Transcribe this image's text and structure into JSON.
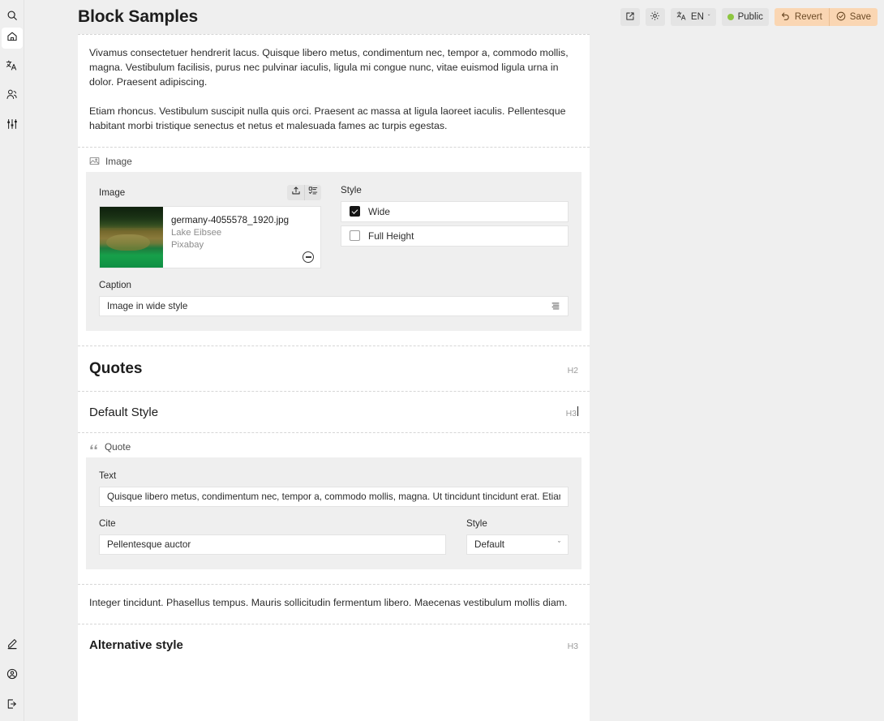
{
  "sidebar": {
    "search_icon": "search-icon",
    "top_items": [
      {
        "icon": "home-icon",
        "name": "home",
        "active": true
      },
      {
        "icon": "translate-icon",
        "name": "translations",
        "active": false
      },
      {
        "icon": "users-icon",
        "name": "users",
        "active": false
      },
      {
        "icon": "sliders-icon",
        "name": "settings",
        "active": false
      }
    ],
    "bottom_items": [
      {
        "icon": "pencil-icon",
        "name": "edit"
      },
      {
        "icon": "account-circle-icon",
        "name": "account"
      },
      {
        "icon": "logout-icon",
        "name": "logout"
      }
    ]
  },
  "header": {
    "title": "Block Samples",
    "preview_icon": "external-link-icon",
    "settings_icon": "gear-icon",
    "language": {
      "icon": "translate-icon",
      "label": "EN",
      "chevron": "ˇ"
    },
    "status": {
      "label": "Public",
      "color": "#8dc63f"
    },
    "revert": {
      "label": "Revert",
      "icon": "undo-icon"
    },
    "save": {
      "label": "Save",
      "icon": "check-circle-icon"
    },
    "action_bg": "#fad6b3",
    "action_fg": "#6b4a26"
  },
  "content": {
    "intro_paragraphs": [
      "Vivamus consectetuer hendrerit lacus. Quisque libero metus, condimentum nec, tempor a, commodo mollis, magna. Vestibulum facilisis, purus nec pulvinar iaculis, ligula mi congue nunc, vitae euismod ligula urna in dolor. Praesent adipiscing.",
      "Etiam rhoncus. Vestibulum suscipit nulla quis orci. Praesent ac massa at ligula laoreet iaculis. Pellentesque habitant morbi tristique senectus et netus et malesuada fames ac turpis egestas."
    ],
    "image_block": {
      "block_label": "Image",
      "block_icon": "image-icon",
      "image_field_label": "Image",
      "upload_icon": "upload-icon",
      "browse_icon": "media-list-icon",
      "media": {
        "filename": "germany-4055578_1920.jpg",
        "title": "Lake Eibsee",
        "source": "Pixabay",
        "remove_icon": "minus-circle-icon"
      },
      "style_label": "Style",
      "style_options": [
        {
          "label": "Wide",
          "checked": true
        },
        {
          "label": "Full Height",
          "checked": false
        }
      ],
      "caption_label": "Caption",
      "caption_value": "Image in wide style",
      "caption_trailing_icon": "text-format-icon"
    },
    "quotes_heading": {
      "text": "Quotes",
      "tag": "H2"
    },
    "default_style_heading": {
      "text": "Default Style",
      "tag": "H3"
    },
    "quote_block": {
      "block_label": "Quote",
      "block_icon": "quote-icon",
      "text_label": "Text",
      "text_value": "Quisque libero metus, condimentum nec, tempor a, commodo mollis, magna. Ut tincidunt tincidunt erat. Etiam iac",
      "cite_label": "Cite",
      "cite_value": "Pellentesque auctor",
      "style_label": "Style",
      "style_value": "Default",
      "style_chevron": "ˇ"
    },
    "outro_paragraph": "Integer tincidunt. Phasellus tempus. Mauris sollicitudin fermentum libero. Maecenas vestibulum mollis diam.",
    "alternative_heading": {
      "text": "Alternative style",
      "tag": "H3"
    }
  }
}
